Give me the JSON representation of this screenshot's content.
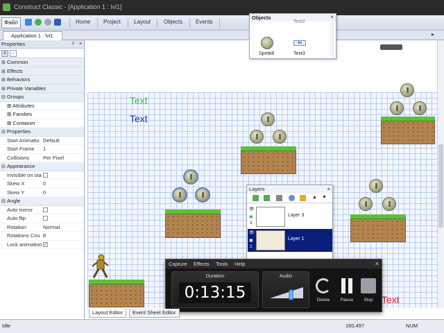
{
  "window": {
    "title": "Construct Classic - [Application 1 : lvl1]"
  },
  "ribbon": {
    "file_menu": "Файл",
    "tabs": [
      "Home",
      "Project",
      "Layout",
      "Objects",
      "Events"
    ]
  },
  "doc_tab": {
    "label": "Application 1 : lvl1"
  },
  "properties": {
    "title": "Properties",
    "pin": "ᵖ",
    "close": "×",
    "categories": {
      "common": "Common",
      "effects": "Effects",
      "behaviors": "Behaviors",
      "private_variables": "Private Variables",
      "groups": "Groups",
      "attributes": "Attributes",
      "families": "Families",
      "container": "Container",
      "properties": "Properties",
      "appearance": "Appearance",
      "angle": "Angle"
    },
    "rows": {
      "start_animation": {
        "name": "Start Animatio",
        "value": "Default"
      },
      "start_frame": {
        "name": "Start Frame",
        "value": "1"
      },
      "collisions": {
        "name": "Collisions",
        "value": "Per Pixel"
      },
      "invisible": {
        "name": "Invisible on sta",
        "checked": false
      },
      "skew_x": {
        "name": "Skew X",
        "value": "0"
      },
      "skew_y": {
        "name": "Skew Y",
        "value": "0"
      },
      "auto_mirror": {
        "name": "Auto mirror",
        "checked": false
      },
      "auto_flip": {
        "name": "Auto flip",
        "checked": false
      },
      "rotation": {
        "name": "Rotation",
        "value": "Normal"
      },
      "rotations_count": {
        "name": "Rotations Cou",
        "value": "8"
      },
      "lock_animation": {
        "name": "Lock animation",
        "checked": true
      }
    }
  },
  "canvas": {
    "text_green": "Text",
    "text_blue": "Text",
    "text_red": "Text",
    "colors": {
      "green": "#3bbf3b",
      "blue": "#1a2fb5",
      "red": "#e21a1a"
    }
  },
  "objects_panel": {
    "title": "Objects",
    "top_partial": "Text2",
    "items": [
      {
        "label": "Sprite8",
        "icon": "coin-sprite-icon"
      },
      {
        "label": "Text3",
        "icon": "text-object-icon",
        "icon_text": "Aa"
      }
    ]
  },
  "layers_panel": {
    "title": "Layers",
    "close": "×",
    "layers": [
      {
        "name": "Layer 3",
        "number": "3",
        "selected": false
      },
      {
        "name": "Layer 1",
        "number": "2",
        "selected": true
      }
    ]
  },
  "capture": {
    "menu": [
      "Capture",
      "Effects",
      "Tools",
      "Help"
    ],
    "close": "×",
    "duration_label": "Duration",
    "duration": "0:13:15",
    "audio_label": "Audio",
    "buttons": [
      "Delete",
      "Pause",
      "Stop"
    ]
  },
  "bottom_tabs": [
    "Layout Editor",
    "Event Sheet Editor"
  ],
  "status": {
    "left": "Idle",
    "coords": "160,497",
    "num": "NUM"
  }
}
